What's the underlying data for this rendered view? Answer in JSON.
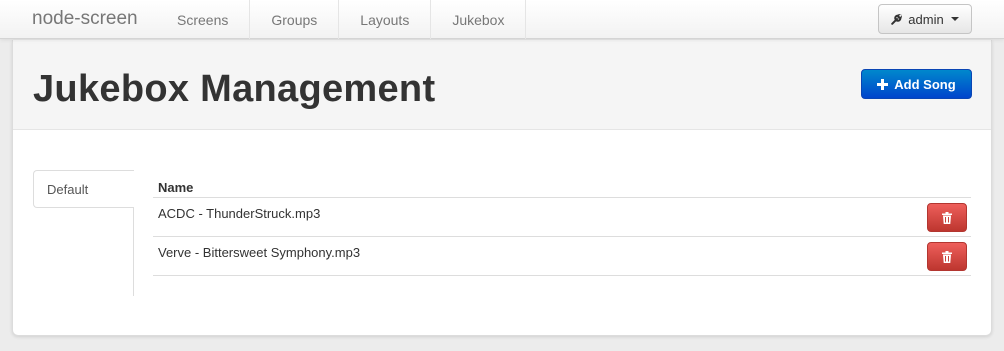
{
  "navbar": {
    "brand": "node-screen",
    "items": [
      {
        "label": "Screens"
      },
      {
        "label": "Groups"
      },
      {
        "label": "Layouts"
      },
      {
        "label": "Jukebox"
      }
    ],
    "user_menu": {
      "label": "admin",
      "icon": "wrench-icon"
    }
  },
  "header": {
    "title": "Jukebox Management",
    "add_button_label": "Add Song",
    "add_button_icon": "plus-icon"
  },
  "tabs": [
    {
      "label": "Default",
      "active": true
    }
  ],
  "songs_table": {
    "columns": [
      "Name"
    ],
    "rows": [
      {
        "name": "ACDC - ThunderStruck.mp3"
      },
      {
        "name": "Verve - Bittersweet Symphony.mp3"
      }
    ]
  },
  "colors": {
    "primary": "#0066cc",
    "danger": "#d9534f",
    "navbar_text": "#777777"
  }
}
